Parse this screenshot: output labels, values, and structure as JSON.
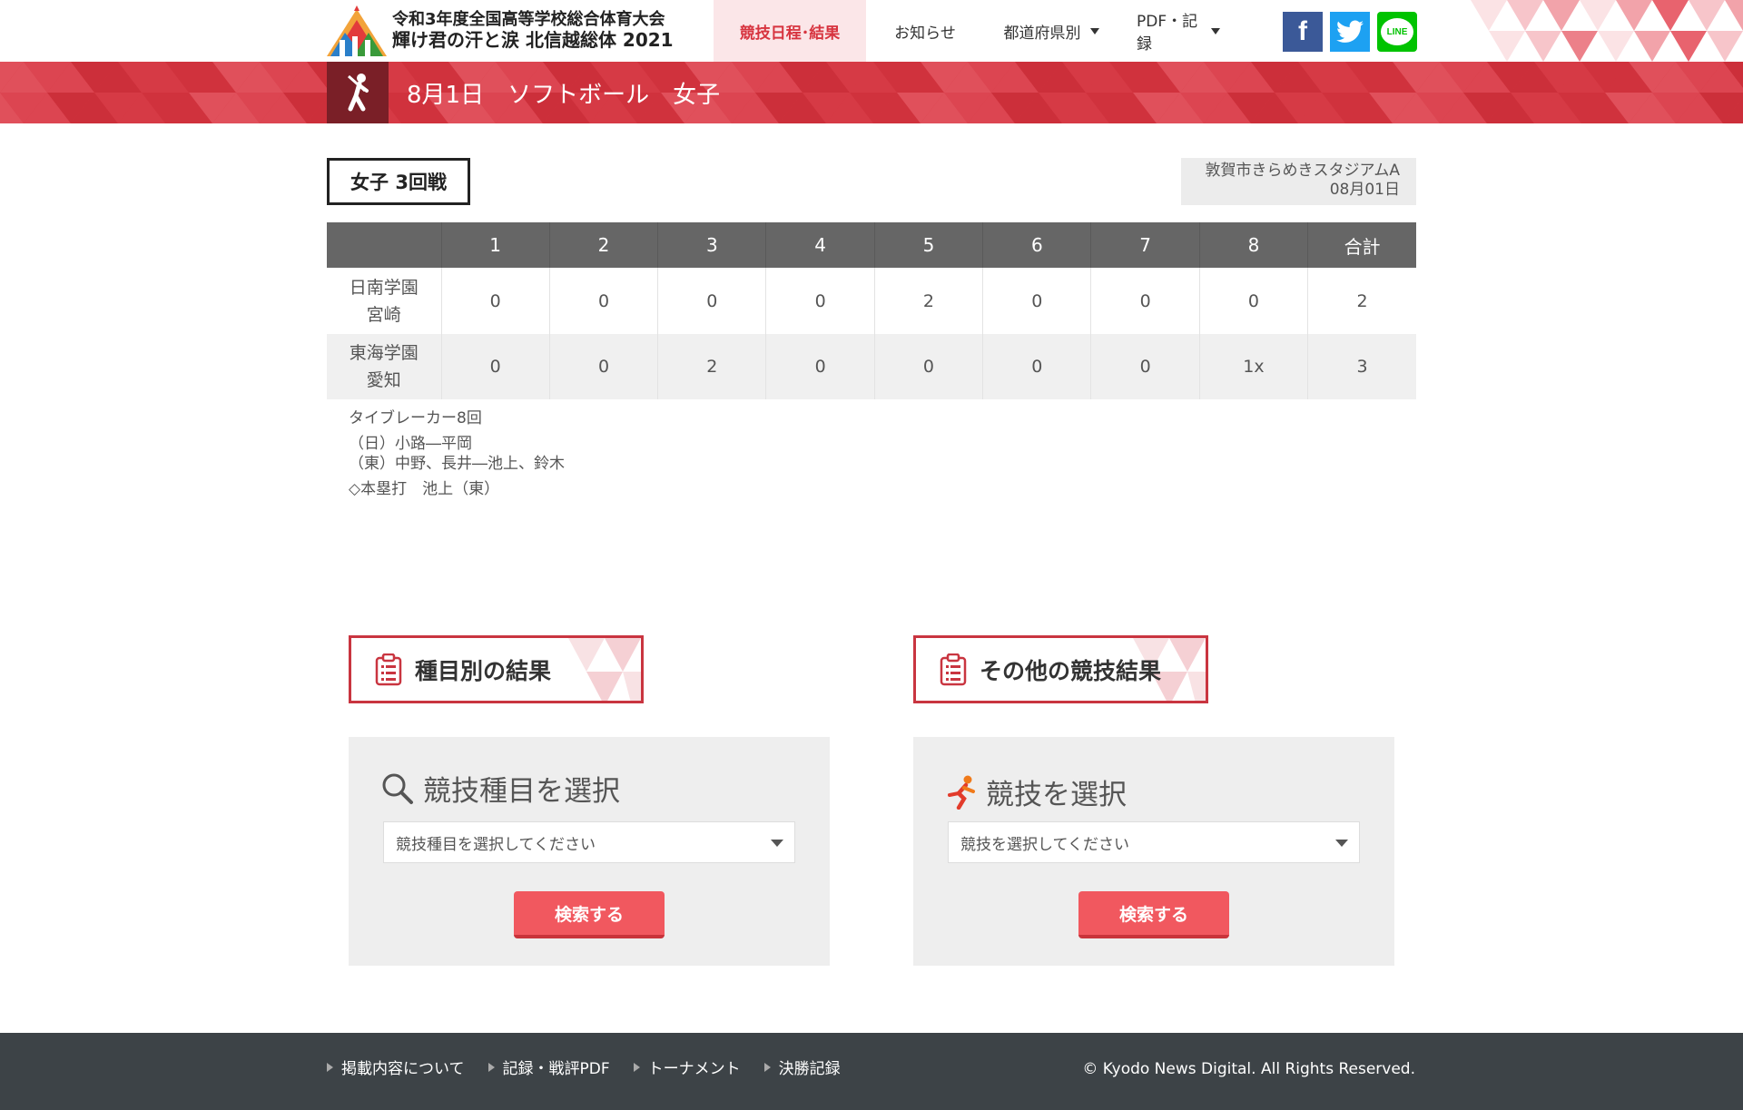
{
  "header": {
    "logo_line1": "令和3年度全国高等学校総合体育大会",
    "logo_line2": "輝け君の汗と涙 北信越総体 2021",
    "logo_year": "2021",
    "nav": [
      {
        "label": "競技日程･結果",
        "active": true
      },
      {
        "label": "お知らせ",
        "active": false
      },
      {
        "label": "都道府県別",
        "active": false
      },
      {
        "label": "PDF・記録",
        "active": false
      }
    ],
    "social": {
      "facebook": "f",
      "line": "LINE"
    }
  },
  "band": {
    "title": "8月1日　ソフトボール　女子",
    "icon": "softball-batter-icon"
  },
  "game": {
    "round": "女子 3回戦",
    "venue": "敦賀市きらめきスタジアムA",
    "date": "08月01日"
  },
  "scoreboard": {
    "headers": [
      "",
      "1",
      "2",
      "3",
      "4",
      "5",
      "6",
      "7",
      "8",
      "合計"
    ],
    "rows": [
      {
        "team": "日南学園",
        "pref": "宮崎",
        "innings": [
          "0",
          "0",
          "0",
          "0",
          "2",
          "0",
          "0",
          "0"
        ],
        "total": "2"
      },
      {
        "team": "東海学園",
        "pref": "愛知",
        "innings": [
          "0",
          "0",
          "2",
          "0",
          "0",
          "0",
          "0",
          "1x"
        ],
        "total": "3"
      }
    ]
  },
  "notes": {
    "tiebreaker": "タイブレーカー8回",
    "battery1": "（日）小路―平岡",
    "battery2": "（東）中野、長井―池上、鈴木",
    "homerun": "◇本塁打　池上（東）"
  },
  "search": {
    "left": {
      "section_title": "種目別の結果",
      "panel_title": "競技種目を選択",
      "placeholder": "競技種目を選択してください",
      "button": "検索する"
    },
    "right": {
      "section_title": "その他の競技結果",
      "panel_title": "競技を選択",
      "placeholder": "競技を選択してください",
      "button": "検索する"
    }
  },
  "footer": {
    "links": [
      "掲載内容について",
      "記録・戦評PDF",
      "トーナメント",
      "決勝記録"
    ],
    "copyright": "© Kyodo News Digital. All Rights Reserved."
  },
  "colors": {
    "accent": "#d63a45",
    "button": "#f1585f",
    "footer": "#3d4347",
    "table_header": "#666666"
  }
}
